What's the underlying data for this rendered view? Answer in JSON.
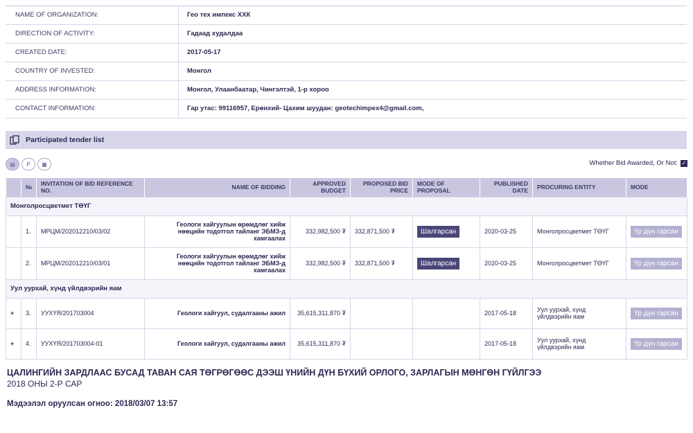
{
  "org_info": [
    {
      "label": "NAME OF ORGANIZATION:",
      "value": "Гео тех импекс ХХК"
    },
    {
      "label": "DIRECTION OF ACTIVITY:",
      "value": "Гадаад худалдаа"
    },
    {
      "label": "CREATED DATE:",
      "value": "2017-05-17"
    },
    {
      "label": "COUNTRY OF INVESTED:",
      "value": "Монгол"
    },
    {
      "label": "ADDRESS INFORMATION:",
      "value": "Монгол, Улаанбаатар, Чингэлтэй, 1-р хороо"
    },
    {
      "label": "CONTACT INFORMATION:",
      "value": "Гар утас: 99116957, Ерөнхий- Цахим шуудан: geotechimpex4@gmail.com,"
    }
  ],
  "section": {
    "title": "Participated tender list",
    "icon": "copy-icon"
  },
  "view_buttons": [
    {
      "icon": "list-view-icon",
      "glyph": "▤"
    },
    {
      "icon": "tender-view-icon",
      "glyph": "Р"
    },
    {
      "icon": "calendar-view-icon",
      "glyph": "▦"
    }
  ],
  "awarded_filter": {
    "label": "Whether Bid Awarded, Or Not:",
    "checked": true
  },
  "columns": {
    "no": "№",
    "ref": "INVITATION OF BID REFERENCE NO.",
    "name": "NAME OF BIDDING",
    "budget": "APPROVED BUDGET",
    "price": "PROPOSED BID PRICE",
    "mode_proposal": "MODE OF PROPOSAL",
    "published": "PUBLISHED DATE",
    "entity": "PROCURING ENTITY",
    "mode": "MODE"
  },
  "groups": [
    {
      "name": "Монголросцветмет ТӨҮГ",
      "rows": [
        {
          "expand": "",
          "no": "1.",
          "ref": "МРЦМ/202012210/03/02",
          "name": "Геологи хайгуулын өрөмдлөг хийж нөөцийн тодотгол тайланг ЭБМЗ-д хамгаалах",
          "budget": "332,982,500 ₮",
          "price": "332,871,500 ₮",
          "mode_proposal": "Шалгарсан",
          "published": "2020-03-25",
          "entity": "Монголросцветмет ТӨҮГ",
          "mode": "Үр дүн гарсан"
        },
        {
          "expand": "",
          "no": "2.",
          "ref": "МРЦМ/202012210/03/01",
          "name": "Геологи хайгуулын өрөмдлөг хийж нөөцийн тодотгол тайланг ЭБМЗ-д хамгаалах",
          "budget": "332,982,500 ₮",
          "price": "332,871,500 ₮",
          "mode_proposal": "Шалгарсан",
          "published": "2020-03-25",
          "entity": "Монголросцветмет ТӨҮГ",
          "mode": "Үр дүн гарсан"
        }
      ]
    },
    {
      "name": "Уул уурхай, хүнд үйлдвэрийн яам",
      "rows": [
        {
          "expand": "+",
          "no": "3.",
          "ref": "УУХҮЯ/201703004",
          "name": "Геологи хайгуул, судалгааны ажил",
          "budget": "35,615,311,870 ₮",
          "price": "",
          "mode_proposal": "",
          "published": "2017-05-18",
          "entity": "Уул уурхай, хүнд үйлдвэрийн яам",
          "mode": "Үр дүн гарсан"
        },
        {
          "expand": "+",
          "no": "4.",
          "ref": "УУХҮЯ/201703004-01",
          "name": "Геологи хайгуул, судалгааны ажил",
          "budget": "35,615,311,870 ₮",
          "price": "",
          "mode_proposal": "",
          "published": "2017-05-18",
          "entity": "Уул уурхай, хүнд үйлдвэрийн яам",
          "mode": "Үр дүн гарсан"
        }
      ]
    }
  ],
  "footer": {
    "title": "ЦАЛИНГИЙН ЗАРДЛААС БУСАД ТАВАН САЯ ТӨГРӨГӨӨС ДЭЭШ ҮНИЙН ДҮН БҮХИЙ ОРЛОГО, ЗАРЛАГЫН МӨНГӨН ГҮЙЛГЭЭ",
    "subtitle": "2018 ОНЫ 2-Р САР",
    "entered": "Мэдээлэл оруулсан огноо: 2018/03/07 13:57"
  }
}
